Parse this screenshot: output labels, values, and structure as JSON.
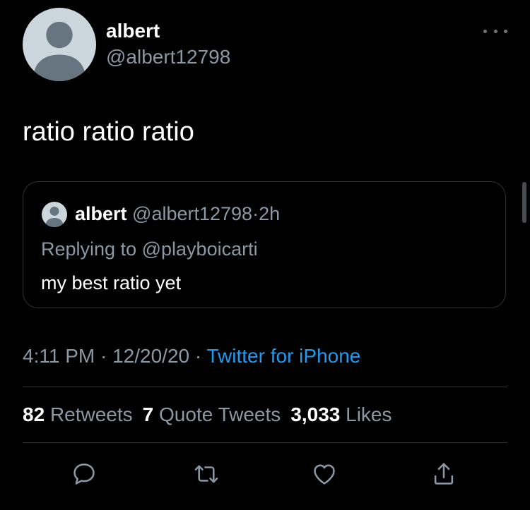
{
  "tweet": {
    "display_name": "albert",
    "handle": "@albert12798",
    "text": "ratio ratio ratio",
    "time": "4:11 PM",
    "date": "12/20/20",
    "source": "Twitter for iPhone",
    "sep": "·"
  },
  "quote": {
    "display_name": "albert",
    "handle": "@albert12798",
    "time": "2h",
    "replying_prefix": "Replying to",
    "replying_to": "@playboicarti",
    "text": "my best ratio yet"
  },
  "stats": {
    "retweets_count": "82",
    "retweets_label": "Retweets",
    "quotes_count": "7",
    "quotes_label": "Quote Tweets",
    "likes_count": "3,033",
    "likes_label": "Likes"
  },
  "icons": {
    "more": "more-horizontal-icon",
    "reply": "reply-bubble-icon",
    "retweet": "retweet-icon",
    "like": "heart-icon",
    "share": "share-upload-icon"
  },
  "colors": {
    "background": "#000000",
    "primary_text": "#ffffff",
    "secondary_text": "#8b98a5",
    "link": "#1d9bf0",
    "border": "#2f3336",
    "avatar_bg": "#ccd6dd",
    "avatar_fg": "#66757f"
  }
}
